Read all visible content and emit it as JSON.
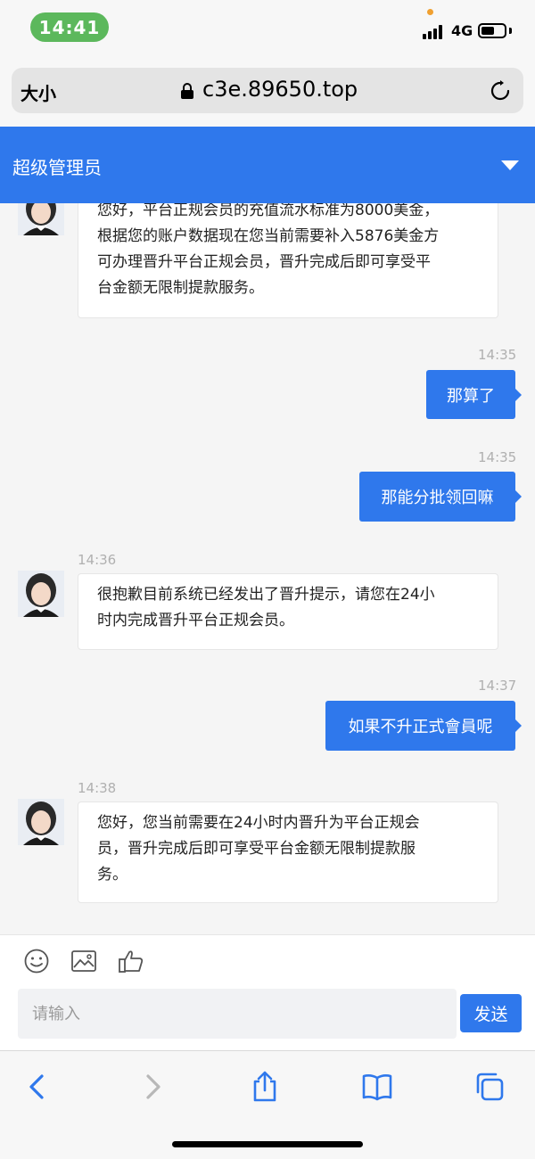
{
  "status_bar": {
    "time": "14:41",
    "network": "4G"
  },
  "browser": {
    "text_size_label": "大小",
    "url": "c3e.89650.top"
  },
  "header": {
    "title": "超级管理员"
  },
  "messages": [
    {
      "side": "in",
      "text_lines": [
        "您好，平台正规会员的充值流水标准为8000美金，",
        "根据您的账户数据现在您当前需要补入5876美金方",
        "可办理晋升平台正规会员，晋升完成后即可享受平",
        "台金额无限制提款服务。"
      ]
    },
    {
      "side": "out",
      "time": "14:35",
      "text": "那算了"
    },
    {
      "side": "out",
      "time": "14:35",
      "text": "那能分批领回嘛"
    },
    {
      "side": "in",
      "time": "14:36",
      "text_lines": [
        "很抱歉目前系统已经发出了晋升提示，请您在24小",
        "时内完成晋升平台正规会员。"
      ]
    },
    {
      "side": "out",
      "time": "14:37",
      "text": "如果不升正式會員呢"
    },
    {
      "side": "in",
      "time": "14:38",
      "text_lines": [
        "您好，您当前需要在24小时内晋升为平台正规会",
        "员，晋升完成后即可享受平台金额无限制提款服",
        "务。"
      ]
    }
  ],
  "composer": {
    "icons": [
      "emoji-icon",
      "image-icon",
      "thumbs-up-icon"
    ],
    "placeholder": "请输入",
    "send_label": "发送"
  },
  "colors": {
    "accent": "#2f78ec",
    "time_pill": "#5cb85c",
    "timestamp": "#b0b0b0"
  }
}
